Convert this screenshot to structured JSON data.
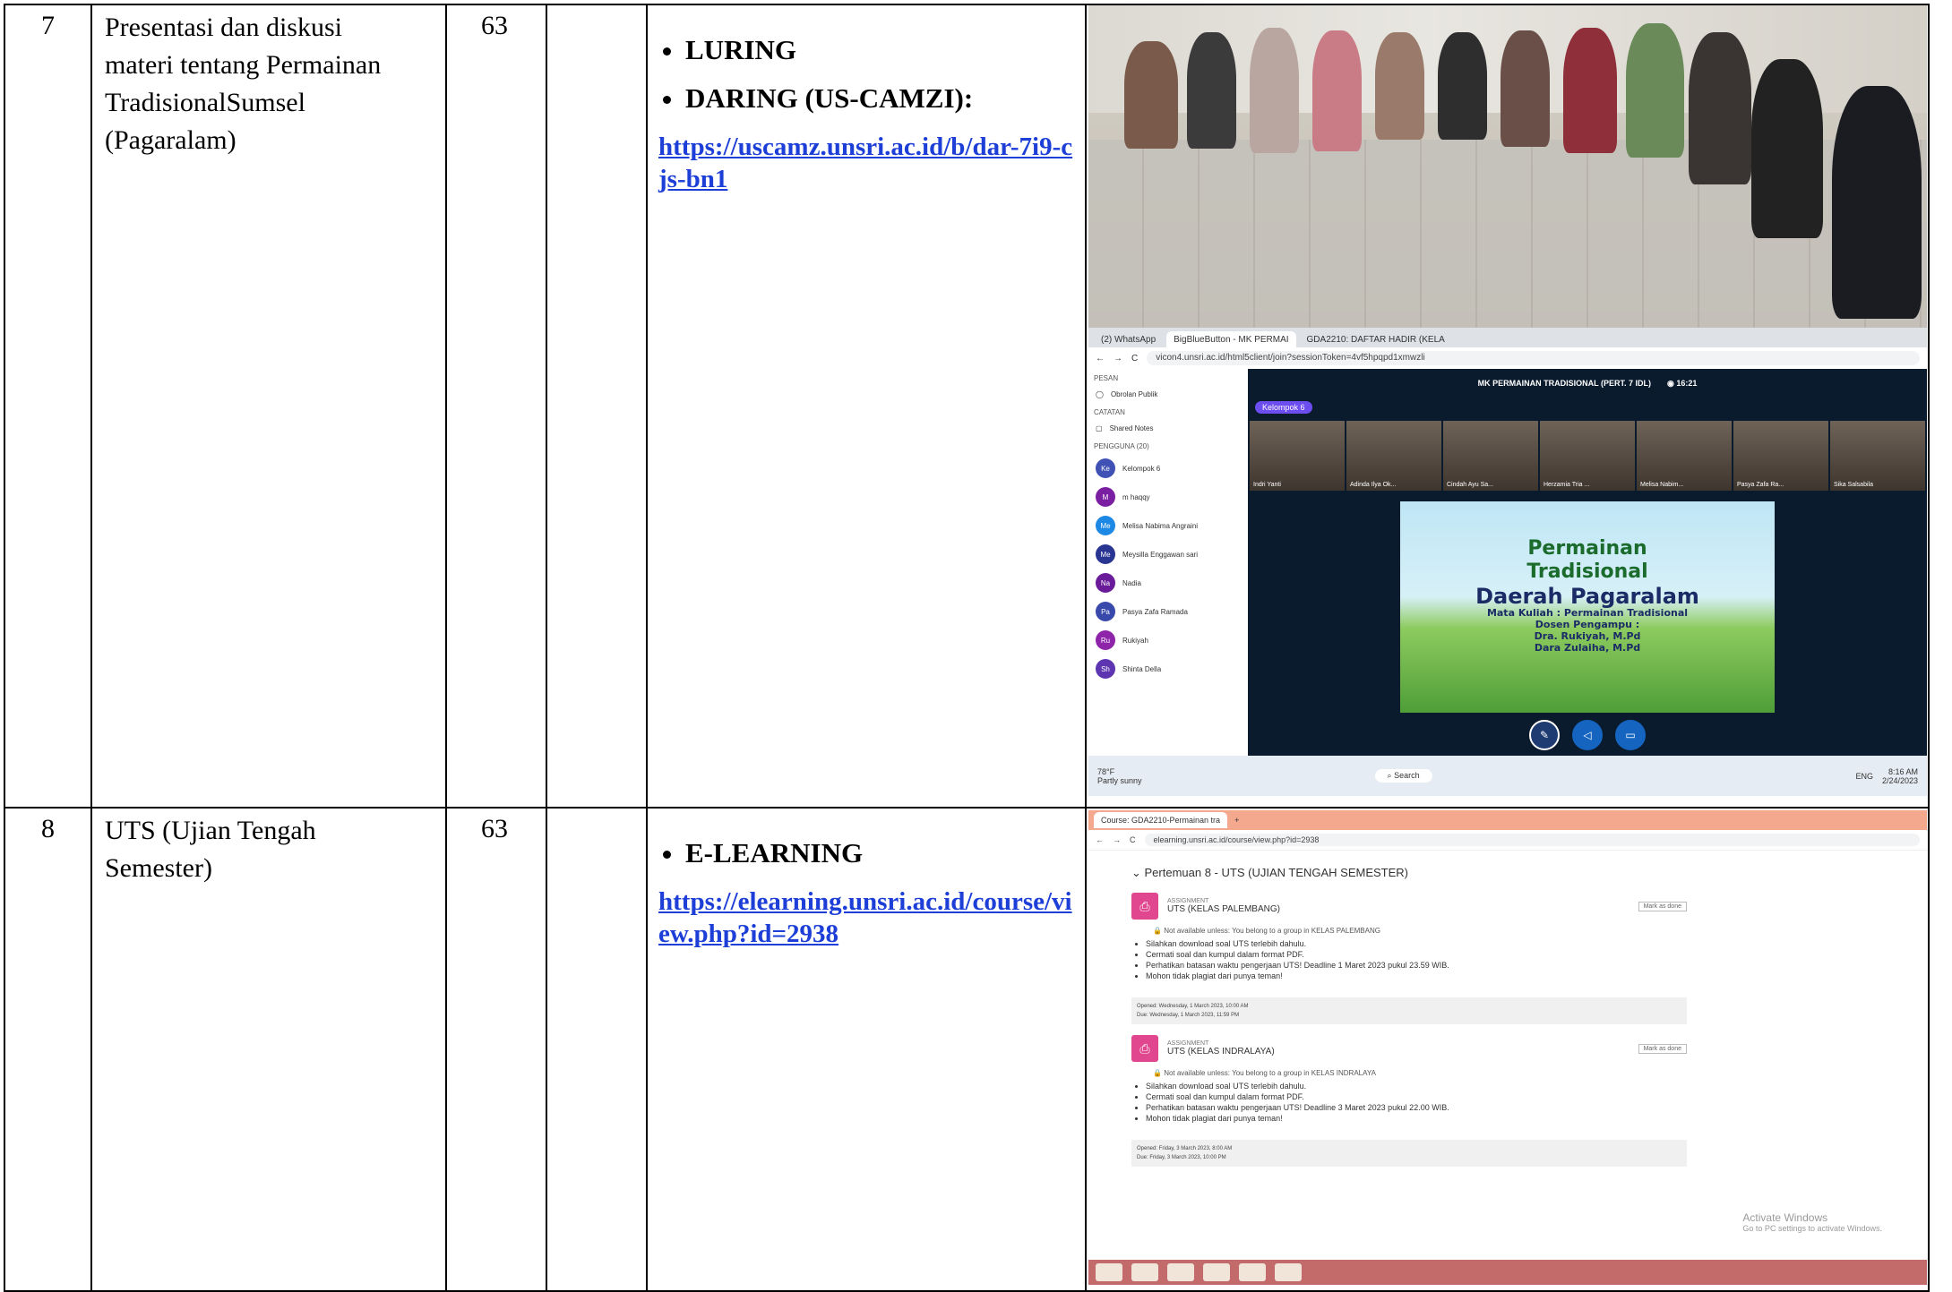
{
  "rows": [
    {
      "no": "7",
      "topic": [
        "Presentasi dan diskusi",
        "materi tentang Permainan",
        "TradisionalSumsel",
        "(Pagaralam)"
      ],
      "count": "63",
      "methods": [
        "LURING",
        "DARING (US-CAMZI):"
      ],
      "link": "https://uscamz.unsri.ac.id/b/dar-7i9-cjs-bn1"
    },
    {
      "no": "8",
      "topic": [
        "UTS (Ujian Tengah",
        "Semester)"
      ],
      "count": "63",
      "methods": [
        "E-LEARNING"
      ],
      "link": "https://elearning.unsri.ac.id/course/view.php?id=2938"
    }
  ],
  "bbb": {
    "tabs": [
      "(2) WhatsApp",
      "BigBlueButton - MK PERMAI",
      "GDA2210: DAFTAR HADIR (KELA"
    ],
    "url": "vicon4.unsri.ac.id/html5client/join?sessionToken=4vf5hpqpd1xmwzli",
    "side_pesan": "PESAN",
    "side_public": "Obrolan Publik",
    "side_catatan": "CATATAN",
    "side_notes": "Shared Notes",
    "side_pengguna": "PENGGUNA (20)",
    "users": [
      {
        "init": "Ke",
        "name": "Kelompok 6",
        "color": "#3f51b5"
      },
      {
        "init": "M",
        "name": "m haqqy",
        "color": "#7b1fa2"
      },
      {
        "init": "Me",
        "name": "Melisa Nabima Angraini",
        "color": "#1e88e5"
      },
      {
        "init": "Me",
        "name": "Meysilla Enggawan sari",
        "color": "#283593"
      },
      {
        "init": "Na",
        "name": "Nadia",
        "color": "#6a1b9a"
      },
      {
        "init": "Pa",
        "name": "Pasya Zafa Ramada",
        "color": "#3949ab"
      },
      {
        "init": "Ru",
        "name": "Rukiyah",
        "color": "#8e24aa"
      },
      {
        "init": "Sh",
        "name": "Shinta Della",
        "color": "#5e35b1"
      }
    ],
    "meeting_title": "MK PERMAINAN TRADISIONAL (PERT. 7 IDL)",
    "time": "16:21",
    "group": "Kelompok 6",
    "cams": [
      "Indri Yanti",
      "Adinda Ilya Ok...",
      "Cindah Ayu Sa...",
      "Herzamia Tria ...",
      "Melisa Nabim...",
      "Pasya Zafa Ra...",
      "Sika Salsabila"
    ],
    "slide_title": [
      "Permainan",
      "Tradisional",
      "Daerah Pagaralam"
    ],
    "slide_sub": [
      "Mata Kuliah : Permainan Tradisional",
      "Dosen Pengampu :",
      "Dra. Rukiyah, M.Pd",
      "Dara Zulaiha, M.Pd"
    ],
    "weather_temp": "78°F",
    "weather": "Partly sunny",
    "search": "Search",
    "lang": "ENG",
    "clock_time": "8:16 AM",
    "clock_date": "2/24/2023"
  },
  "elearning": {
    "tab": "Course: GDA2210-Permainan tra",
    "url": "elearning.unsri.ac.id/course/view.php?id=2938",
    "section": "Pertemuan 8 - UTS (UJIAN TENGAH SEMESTER)",
    "asg_label": "ASSIGNMENT",
    "mark": "Mark as done",
    "a1": {
      "title": "UTS (KELAS PALEMBANG)",
      "restr": "Not available unless: You belong to a group in KELAS PALEMBANG",
      "items": [
        "Silahkan download soal UTS terlebih dahulu.",
        "Cermati soal dan kumpul dalam format PDF.",
        "Perhatikan batasan waktu pengerjaan UTS! Deadline 1 Maret 2023 pukul 23.59 WIB.",
        "Mohon tidak plagiat dari punya teman!"
      ],
      "opened": "Opened: Wednesday, 1 March 2023, 10:00 AM",
      "due": "Due: Wednesday, 1 March 2023, 11:59 PM"
    },
    "a2": {
      "title": "UTS (KELAS INDRALAYA)",
      "restr": "Not available unless: You belong to a group in KELAS INDRALAYA",
      "items": [
        "Silahkan download soal UTS terlebih dahulu.",
        "Cermati soal dan kumpul dalam format PDF.",
        "Perhatikan batasan waktu pengerjaan UTS! Deadline 3 Maret 2023 pukul 22.00 WIB.",
        "Mohon tidak plagiat dari punya teman!"
      ],
      "opened": "Opened: Friday, 3 March 2023, 8:00 AM",
      "due": "Due: Friday, 3 March 2023, 10:00 PM"
    },
    "win1": "Activate Windows",
    "win2": "Go to PC settings to activate Windows."
  }
}
